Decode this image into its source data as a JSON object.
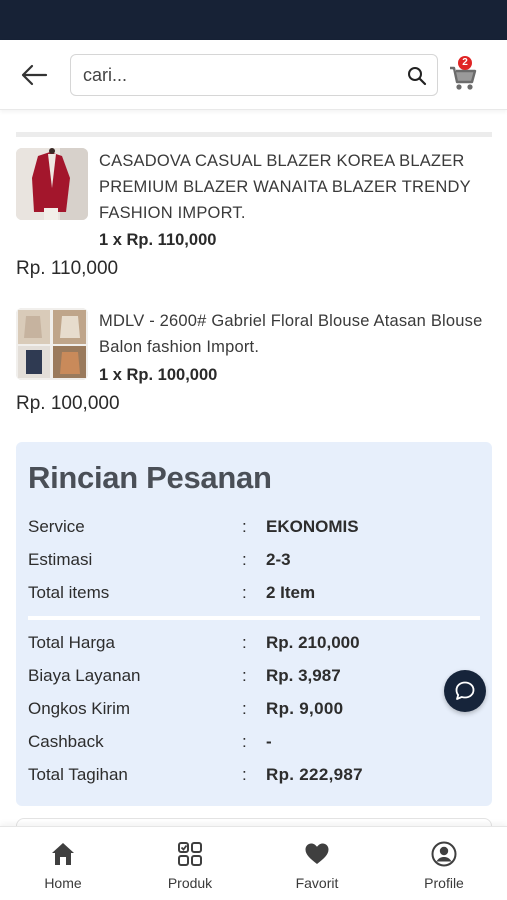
{
  "header": {
    "search_placeholder": "cari...",
    "cart_count": "2"
  },
  "products": [
    {
      "name": "CASADOVA CASUAL BLAZER KOREA BLAZER PREMIUM BLAZER WANAITA BLAZER TRENDY FASHION IMPORT.",
      "qty_price": "1 x Rp. 110,000",
      "subtotal": "Rp. 110,000"
    },
    {
      "name": "MDLV - 2600# Gabriel Floral Blouse Atasan Blouse Balon fashion Import.",
      "qty_price": "1 x Rp. 100,000",
      "subtotal": "Rp. 100,000"
    }
  ],
  "summary": {
    "title": "Rincian Pesanan",
    "rows_top": [
      {
        "label": "Service",
        "colon": ":",
        "value": "EKONOMIS"
      },
      {
        "label": "Estimasi",
        "colon": ":",
        "value": "2-3"
      },
      {
        "label": "Total items",
        "colon": ":",
        "value": "2 Item"
      }
    ],
    "rows_bottom": [
      {
        "label": "Total Harga",
        "colon": ":",
        "value": "Rp. 210,000"
      },
      {
        "label": "Biaya Layanan",
        "colon": ":",
        "value": "Rp. 3,987"
      },
      {
        "label": "Ongkos Kirim",
        "colon": ":",
        "value": "Rp. 9,000"
      },
      {
        "label": "Cashback",
        "colon": ":",
        "value": "-"
      },
      {
        "label": "Total Tagihan",
        "colon": ":",
        "value": "Rp. 222,987"
      }
    ]
  },
  "bottom_nav": [
    {
      "label": "Home",
      "icon": "home-icon"
    },
    {
      "label": "Produk",
      "icon": "grid-icon"
    },
    {
      "label": "Favorit",
      "icon": "heart-icon"
    },
    {
      "label": "Profile",
      "icon": "user-circle-icon"
    }
  ],
  "colors": {
    "status_bar": "#172236",
    "summary_bg": "#e7effb",
    "badge": "#e02424",
    "chat_fab": "#16243a"
  }
}
